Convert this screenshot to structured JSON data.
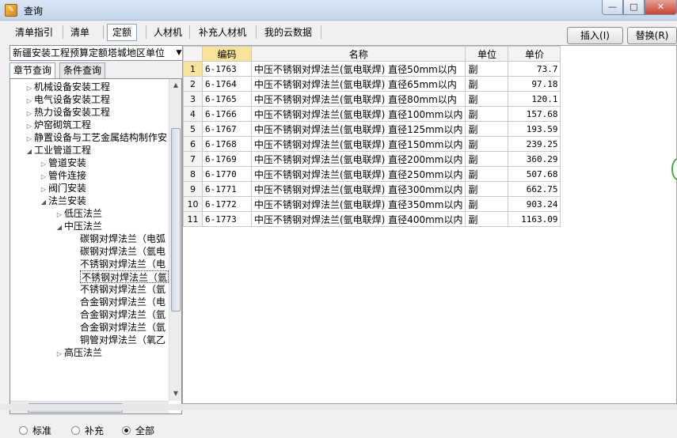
{
  "window": {
    "title": "查询",
    "min": "—",
    "max": "□",
    "close": "✕"
  },
  "toolbar": {
    "tabs": [
      "清单指引",
      "清单",
      "定额",
      "人材机",
      "补充人材机",
      "我的云数据"
    ],
    "active_tab": 2,
    "insert_label": "插入(I)",
    "replace_label": "替换(R)"
  },
  "left": {
    "combo_value": "新疆安装工程预算定额塔城地区单位",
    "subtabs": [
      "章节查询",
      "条件查询"
    ],
    "tree": [
      {
        "label": "机械设备安装工程",
        "level": 0,
        "tri": "▷"
      },
      {
        "label": "电气设备安装工程",
        "level": 0,
        "tri": "▷"
      },
      {
        "label": "热力设备安装工程",
        "level": 0,
        "tri": "▷"
      },
      {
        "label": "炉窑砌筑工程",
        "level": 0,
        "tri": "▷"
      },
      {
        "label": "静置设备与工艺金属结构制作安",
        "level": 0,
        "tri": "▷"
      },
      {
        "label": "工业管道工程",
        "level": 0,
        "tri": "◢"
      },
      {
        "label": "管道安装",
        "level": 1,
        "tri": "▷"
      },
      {
        "label": "管件连接",
        "level": 1,
        "tri": "▷"
      },
      {
        "label": "阀门安装",
        "level": 1,
        "tri": "▷"
      },
      {
        "label": "法兰安装",
        "level": 1,
        "tri": "◢"
      },
      {
        "label": "低压法兰",
        "level": 2,
        "tri": "▷"
      },
      {
        "label": "中压法兰",
        "level": 2,
        "tri": "◢"
      },
      {
        "label": "碳钢对焊法兰（电弧",
        "level": 3,
        "tri": ""
      },
      {
        "label": "碳钢对焊法兰（氩电",
        "level": 3,
        "tri": ""
      },
      {
        "label": "不锈钢对焊法兰（电",
        "level": 3,
        "tri": ""
      },
      {
        "label": "不锈钢对焊法兰（氩",
        "level": 3,
        "tri": "",
        "selected": true
      },
      {
        "label": "不锈钢对焊法兰（氩",
        "level": 3,
        "tri": ""
      },
      {
        "label": "合金钢对焊法兰（电",
        "level": 3,
        "tri": ""
      },
      {
        "label": "合金钢对焊法兰（氩",
        "level": 3,
        "tri": ""
      },
      {
        "label": "合金钢对焊法兰（氩",
        "level": 3,
        "tri": ""
      },
      {
        "label": "铜管对焊法兰（氧乙",
        "level": 3,
        "tri": ""
      },
      {
        "label": "高压法兰",
        "level": 2,
        "tri": "▷"
      }
    ],
    "radios": [
      {
        "label": "标准",
        "on": false
      },
      {
        "label": "补充",
        "on": false
      },
      {
        "label": "全部",
        "on": true
      }
    ]
  },
  "grid": {
    "headers": [
      "编码",
      "名称",
      "单位",
      "单价"
    ],
    "rows": [
      {
        "n": "1",
        "code": "6-1763",
        "name": "中压不锈钢对焊法兰(氩电联焊) 直径50mm以内",
        "unit": "副",
        "price": "73.7"
      },
      {
        "n": "2",
        "code": "6-1764",
        "name": "中压不锈钢对焊法兰(氩电联焊) 直径65mm以内",
        "unit": "副",
        "price": "97.18"
      },
      {
        "n": "3",
        "code": "6-1765",
        "name": "中压不锈钢对焊法兰(氩电联焊) 直径80mm以内",
        "unit": "副",
        "price": "120.1"
      },
      {
        "n": "4",
        "code": "6-1766",
        "name": "中压不锈钢对焊法兰(氩电联焊) 直径100mm以内",
        "unit": "副",
        "price": "157.68"
      },
      {
        "n": "5",
        "code": "6-1767",
        "name": "中压不锈钢对焊法兰(氩电联焊) 直径125mm以内",
        "unit": "副",
        "price": "193.59"
      },
      {
        "n": "6",
        "code": "6-1768",
        "name": "中压不锈钢对焊法兰(氩电联焊) 直径150mm以内",
        "unit": "副",
        "price": "239.25"
      },
      {
        "n": "7",
        "code": "6-1769",
        "name": "中压不锈钢对焊法兰(氩电联焊) 直径200mm以内",
        "unit": "副",
        "price": "360.29"
      },
      {
        "n": "8",
        "code": "6-1770",
        "name": "中压不锈钢对焊法兰(氩电联焊) 直径250mm以内",
        "unit": "副",
        "price": "507.68"
      },
      {
        "n": "9",
        "code": "6-1771",
        "name": "中压不锈钢对焊法兰(氩电联焊) 直径300mm以内",
        "unit": "副",
        "price": "662.75"
      },
      {
        "n": "10",
        "code": "6-1772",
        "name": "中压不锈钢对焊法兰(氩电联焊) 直径350mm以内",
        "unit": "副",
        "price": "903.24"
      },
      {
        "n": "11",
        "code": "6-1773",
        "name": "中压不锈钢对焊法兰(氩电联焊) 直径400mm以内",
        "unit": "副",
        "price": "1163.09"
      }
    ]
  }
}
